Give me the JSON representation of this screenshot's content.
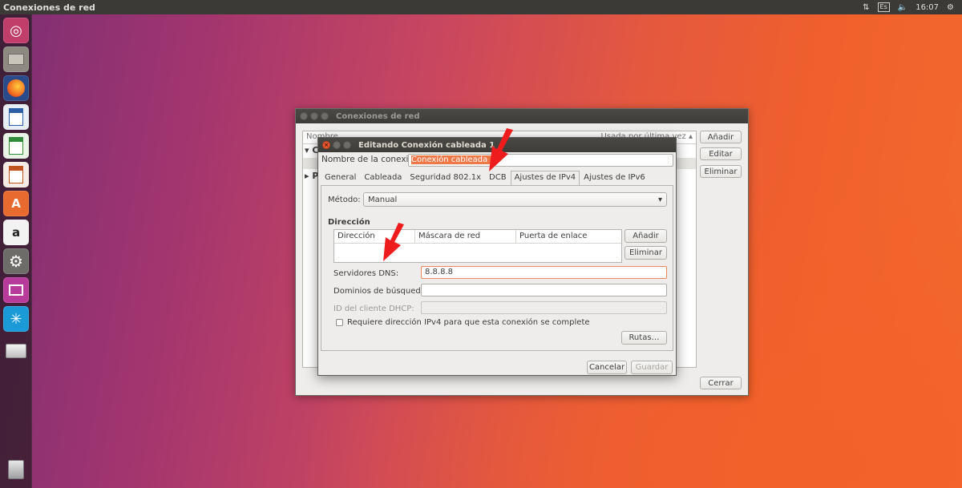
{
  "top_panel": {
    "title": "Conexiones de red",
    "keyboard": "Es",
    "time": "16:07"
  },
  "launcher": {
    "icons": [
      "ubuntu-icon",
      "files-icon",
      "firefox-icon",
      "writer-icon",
      "calc-icon",
      "impress-icon",
      "software-center-icon",
      "amazon-icon",
      "settings-icon",
      "network-icon",
      "workspace-icon",
      "drive-icon",
      "trash-icon"
    ]
  },
  "conn_window": {
    "title": "Conexiones de red",
    "list_header_name": "Nombre",
    "list_header_used": "Usada por última vez",
    "group1": "C",
    "group2": "P",
    "add": "Añadir",
    "edit": "Editar",
    "delete": "Eliminar",
    "close": "Cerrar"
  },
  "edit_dialog": {
    "title": "Editando Conexión cableada 1",
    "name_label": "Nombre de la conexión:",
    "name_value": "Conexión cableada 1",
    "tabs": [
      "General",
      "Cableada",
      "Seguridad 802.1x",
      "DCB",
      "Ajustes de IPv4",
      "Ajustes de IPv6"
    ],
    "active_tab": "Ajustes de IPv4",
    "method_label": "Método:",
    "method_value": "Manual",
    "address_section": "Dirección",
    "columns": [
      "Dirección",
      "Máscara de red",
      "Puerta de enlace"
    ],
    "add_btn": "Añadir",
    "remove_btn": "Eliminar",
    "dns_label": "Servidores DNS:",
    "dns_value": "8.8.8.8",
    "search_label": "Dominios de búsqueda:",
    "search_value": "",
    "dhcp_label": "ID del cliente DHCP:",
    "dhcp_value": "",
    "require_label": "Requiere dirección IPv4 para que esta conexión se complete",
    "routes_btn": "Rutas…",
    "cancel_btn": "Cancelar",
    "save_btn": "Guardar"
  },
  "colors": {
    "accent": "#e95420",
    "arrow": "#ee1c1c"
  }
}
